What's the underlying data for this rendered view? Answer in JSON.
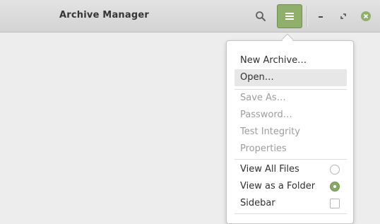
{
  "window": {
    "title": "Archive Manager"
  },
  "header": {
    "search_icon": "search-icon",
    "menu_icon": "hamburger-menu-icon",
    "minimize_icon": "minimize-icon",
    "maximize_icon": "restore-icon",
    "close_icon": "close-icon"
  },
  "menu": {
    "items": [
      {
        "label": "New Archive…",
        "enabled": true
      },
      {
        "label": "Open…",
        "enabled": true,
        "highlighted": true
      },
      {
        "label": "Save As…",
        "enabled": false
      },
      {
        "label": "Password…",
        "enabled": false
      },
      {
        "label": "Test Integrity",
        "enabled": false
      },
      {
        "label": "Properties",
        "enabled": false
      },
      {
        "label": "View All Files",
        "enabled": true,
        "type": "radio",
        "checked": false
      },
      {
        "label": "View as a Folder",
        "enabled": true,
        "type": "radio",
        "checked": true
      },
      {
        "label": "Sidebar",
        "enabled": true,
        "type": "checkbox",
        "checked": false
      }
    ]
  },
  "colors": {
    "accent": "#8faf6b",
    "close_button": "#8faf6b",
    "background": "#ededed",
    "headerbar": "#d8d8d8"
  }
}
